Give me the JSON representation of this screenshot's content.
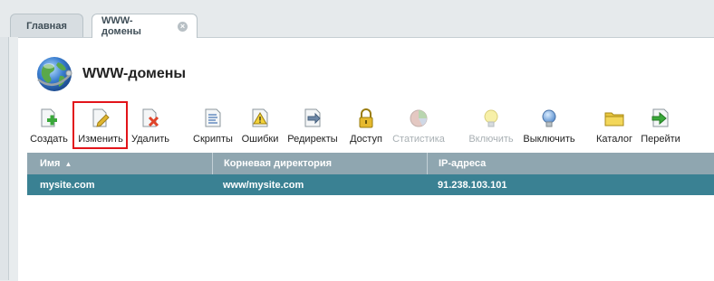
{
  "tabs": [
    {
      "label": "Главная",
      "active": false
    },
    {
      "label": "WWW-домены",
      "active": true,
      "close_icon": "close-icon"
    }
  ],
  "page": {
    "title": "WWW-домены",
    "icon": "globe-icon"
  },
  "toolbar": {
    "buttons": [
      {
        "label": "Создать",
        "icon": "create-icon",
        "enabled": true
      },
      {
        "label": "Изменить",
        "icon": "edit-icon",
        "enabled": true,
        "highlighted": true
      },
      {
        "label": "Удалить",
        "icon": "delete-icon",
        "enabled": true
      },
      {
        "label": "Скрипты",
        "icon": "scripts-icon",
        "enabled": true
      },
      {
        "label": "Ошибки",
        "icon": "errors-icon",
        "enabled": true
      },
      {
        "label": "Редиректы",
        "icon": "redirects-icon",
        "enabled": true
      },
      {
        "label": "Доступ",
        "icon": "lock-icon",
        "enabled": true
      },
      {
        "label": "Статистика",
        "icon": "stats-icon",
        "enabled": false
      },
      {
        "label": "Включить",
        "icon": "bulb-on-icon",
        "enabled": false
      },
      {
        "label": "Выключить",
        "icon": "bulb-off-icon",
        "enabled": true
      },
      {
        "label": "Каталог",
        "icon": "folder-icon",
        "enabled": true
      },
      {
        "label": "Перейти",
        "icon": "go-icon",
        "enabled": true
      }
    ]
  },
  "table": {
    "columns": [
      {
        "label": "Имя",
        "sorted": "asc"
      },
      {
        "label": "Корневая директория"
      },
      {
        "label": "IP-адреса"
      }
    ],
    "rows": [
      {
        "name": "mysite.com",
        "root": "www/mysite.com",
        "ip": "91.238.103.101",
        "selected": true
      }
    ]
  },
  "colors": {
    "header_bg": "#8fa6b0",
    "selected_row_bg": "#3a8193",
    "highlight_border": "#e2141a"
  }
}
